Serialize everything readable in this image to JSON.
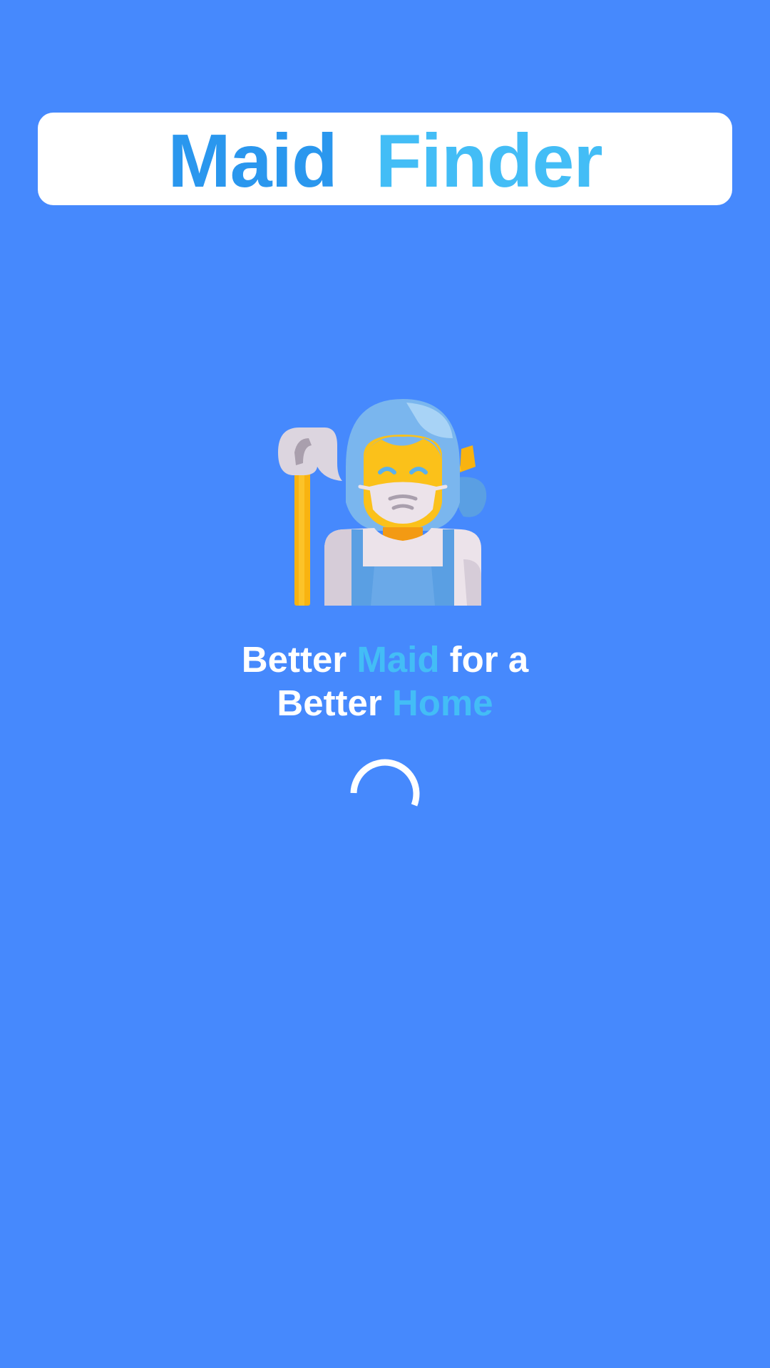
{
  "app": {
    "title_word_1": "Maid",
    "title_word_2": "Finder"
  },
  "tagline": {
    "line1_prefix": "Better",
    "line1_accent": "Maid",
    "line1_suffix": "for a",
    "line2_prefix": "Better",
    "line2_accent": "Home"
  },
  "icons": {
    "mascot": "maid-with-mop-icon",
    "loader": "loading-spinner-icon"
  },
  "colors": {
    "background": "#4689fd",
    "card": "#ffffff",
    "title_primary": "#2a97ee",
    "title_secondary": "#43bdf6",
    "tagline_text": "#ffffff",
    "tagline_accent": "#43bdf6"
  }
}
